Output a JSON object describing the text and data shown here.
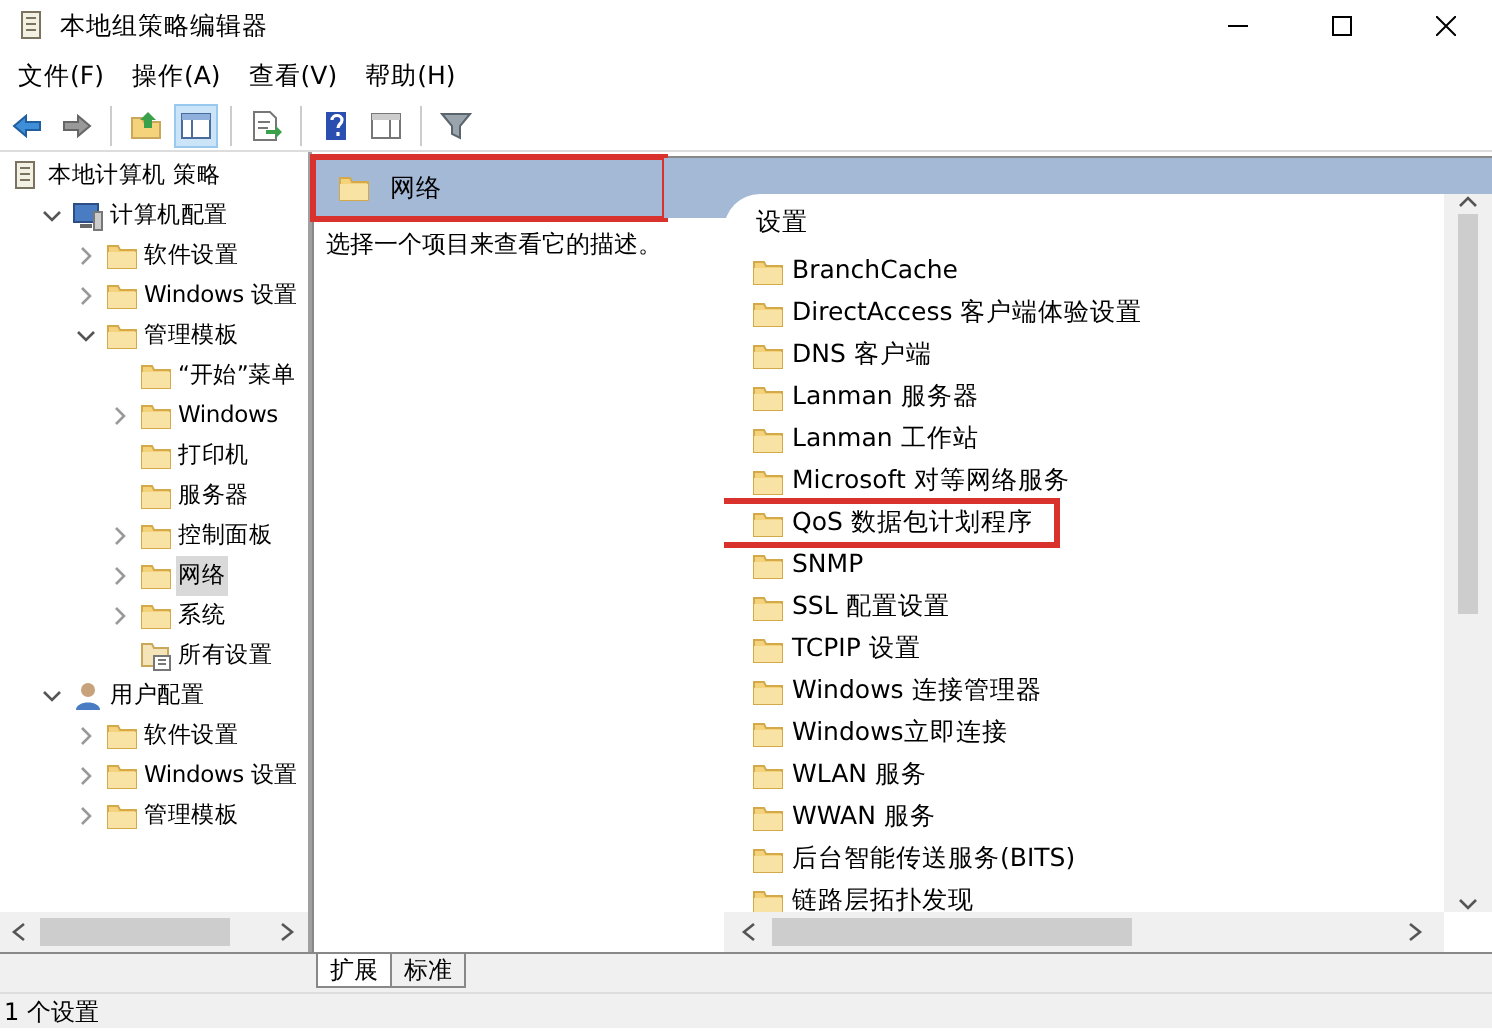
{
  "window": {
    "title": "本地组策略编辑器"
  },
  "menu": [
    "文件(F)",
    "操作(A)",
    "查看(V)",
    "帮助(H)"
  ],
  "toolbar": [
    {
      "kind": "back"
    },
    {
      "kind": "forward"
    },
    {
      "kind": "sep"
    },
    {
      "kind": "up"
    },
    {
      "kind": "showtree",
      "selected": true
    },
    {
      "kind": "sep"
    },
    {
      "kind": "export"
    },
    {
      "kind": "sep"
    },
    {
      "kind": "help"
    },
    {
      "kind": "properties"
    },
    {
      "kind": "sep"
    },
    {
      "kind": "filter"
    }
  ],
  "tree": [
    {
      "label": "本地计算机 策略",
      "kind": "policy",
      "selected": false,
      "children": [
        {
          "label": "计算机配置",
          "kind": "computer",
          "expanded": true,
          "selected": false,
          "children": [
            {
              "label": "软件设置",
              "kind": "folder",
              "expanded": false,
              "selected": false
            },
            {
              "label": "Windows 设置",
              "kind": "folder",
              "expanded": false,
              "selected": false
            },
            {
              "label": "管理模板",
              "kind": "folder",
              "expanded": true,
              "selected": false,
              "children": [
                {
                  "label": "“开始”菜单",
                  "kind": "folder",
                  "selected": false
                },
                {
                  "label": "Windows",
                  "kind": "folder",
                  "expanded": false,
                  "selected": false
                },
                {
                  "label": "打印机",
                  "kind": "folder",
                  "selected": false
                },
                {
                  "label": "服务器",
                  "kind": "folder",
                  "selected": false
                },
                {
                  "label": "控制面板",
                  "kind": "folder",
                  "expanded": false,
                  "selected": false
                },
                {
                  "label": "网络",
                  "kind": "folder",
                  "expanded": false,
                  "selected": true
                },
                {
                  "label": "系统",
                  "kind": "folder",
                  "expanded": false,
                  "selected": false
                },
                {
                  "label": "所有设置",
                  "kind": "settings",
                  "selected": false
                }
              ]
            }
          ]
        },
        {
          "label": "用户配置",
          "kind": "user",
          "expanded": true,
          "selected": false,
          "children": [
            {
              "label": "软件设置",
              "kind": "folder",
              "expanded": false,
              "selected": false
            },
            {
              "label": "Windows 设置",
              "kind": "folder",
              "expanded": false,
              "selected": false
            },
            {
              "label": "管理模板",
              "kind": "folder",
              "expanded": false,
              "selected": false
            }
          ]
        }
      ]
    }
  ],
  "header": {
    "title": "网络",
    "highlighted": true
  },
  "description": "选择一个项目来查看它的描述。",
  "list": {
    "column": "设置",
    "items": [
      {
        "label": "BranchCache",
        "highlighted": false
      },
      {
        "label": "DirectAccess 客户端体验设置",
        "highlighted": false
      },
      {
        "label": "DNS 客户端",
        "highlighted": false
      },
      {
        "label": "Lanman 服务器",
        "highlighted": false
      },
      {
        "label": "Lanman 工作站",
        "highlighted": false
      },
      {
        "label": "Microsoft 对等网络服务",
        "highlighted": false
      },
      {
        "label": "QoS 数据包计划程序",
        "highlighted": true
      },
      {
        "label": "SNMP",
        "highlighted": false
      },
      {
        "label": "SSL 配置设置",
        "highlighted": false
      },
      {
        "label": "TCPIP 设置",
        "highlighted": false
      },
      {
        "label": "Windows 连接管理器",
        "highlighted": false
      },
      {
        "label": "Windows立即连接",
        "highlighted": false
      },
      {
        "label": "WLAN 服务",
        "highlighted": false
      },
      {
        "label": "WWAN 服务",
        "highlighted": false
      },
      {
        "label": "后台智能传送服务(BITS)",
        "highlighted": false
      },
      {
        "label": "链路层拓扑发现",
        "highlighted": false
      }
    ]
  },
  "tabs": [
    {
      "label": "扩展",
      "selected": true
    },
    {
      "label": "标准",
      "selected": false
    }
  ],
  "status_bar": "1 个设置"
}
